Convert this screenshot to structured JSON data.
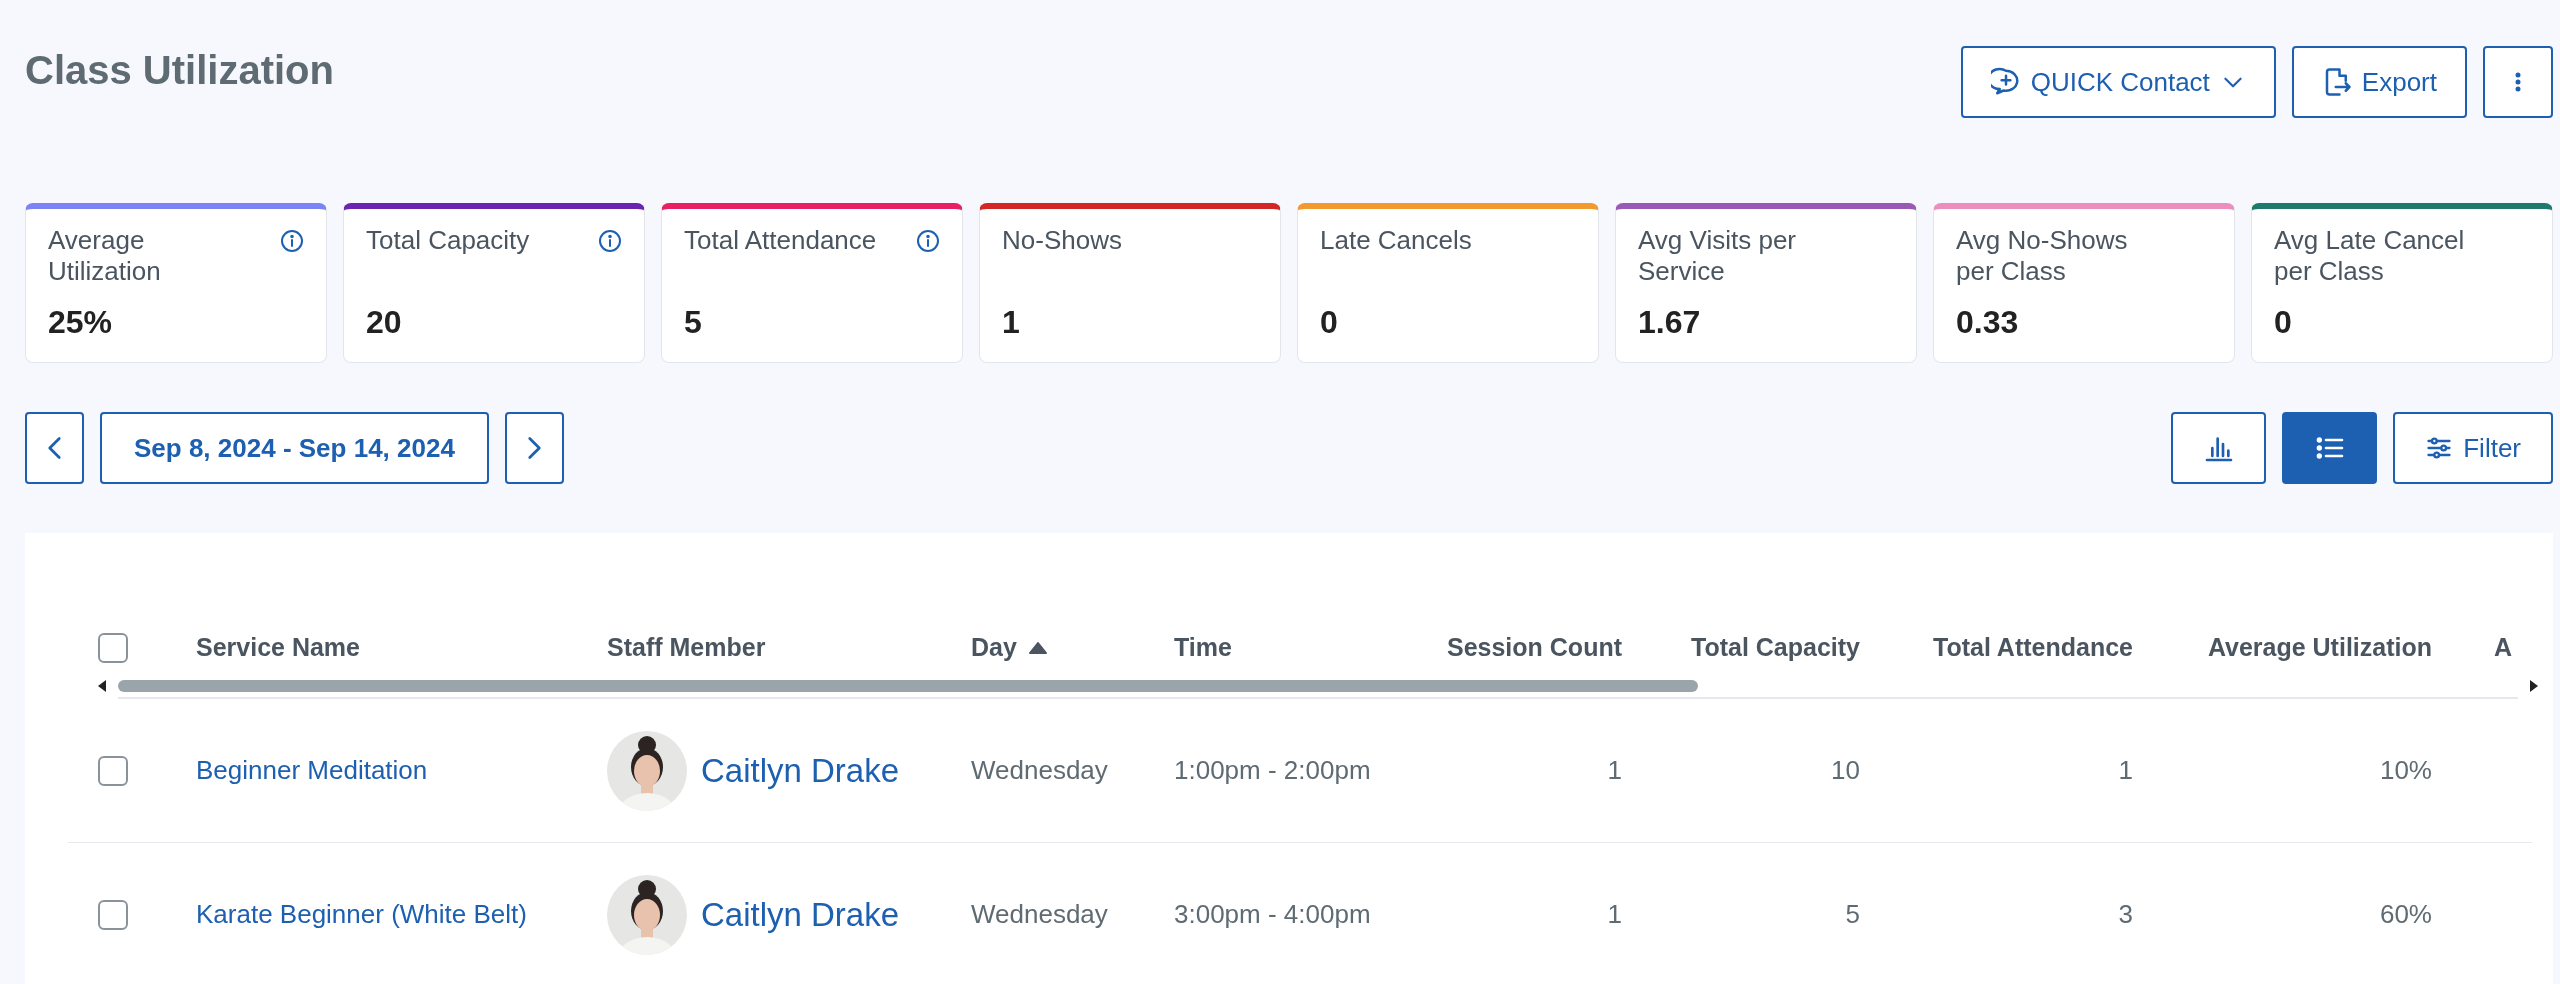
{
  "page": {
    "title": "Class Utilization"
  },
  "header_buttons": [
    {
      "kind": "contact",
      "label": "QUICK Contact"
    },
    {
      "kind": "export",
      "label": "Export"
    },
    {
      "kind": "more"
    }
  ],
  "stats": [
    {
      "label": "Average Utilization",
      "value": "25%",
      "info": true,
      "color": "#7b83f5"
    },
    {
      "label": "Total Capacity",
      "value": "20",
      "info": true,
      "color": "#6a24b0"
    },
    {
      "label": "Total Attendance",
      "value": "5",
      "info": true,
      "color": "#e91e63"
    },
    {
      "label": "No-Shows",
      "value": "1",
      "info": false,
      "color": "#d32626"
    },
    {
      "label": "Late Cancels",
      "value": "0",
      "info": false,
      "color": "#f39a2e"
    },
    {
      "label": "Avg Visits per Service",
      "value": "1.67",
      "info": false,
      "color": "#9b59b6"
    },
    {
      "label": "Avg No-Shows per Class",
      "value": "0.33",
      "info": false,
      "color": "#ec8fbf"
    },
    {
      "label": "Avg Late Cancel per Class",
      "value": "0",
      "info": false,
      "color": "#1f7a6e"
    }
  ],
  "date_range": {
    "label": "Sep 8, 2024 - Sep 14, 2024"
  },
  "view_toggle": [
    {
      "kind": "chart",
      "selected": false
    },
    {
      "kind": "list",
      "selected": true
    }
  ],
  "filter_button": {
    "label": "Filter"
  },
  "table": {
    "select_all": {
      "checked": false
    },
    "columns": [
      {
        "label": "Service Name",
        "kind": "text",
        "sorted": false
      },
      {
        "label": "Staff Member",
        "kind": "text",
        "sorted": false
      },
      {
        "label": "Day",
        "kind": "text",
        "sorted": true
      },
      {
        "label": "Time",
        "kind": "text",
        "sorted": false
      },
      {
        "label": "Session Count",
        "kind": "number",
        "sorted": false
      },
      {
        "label": "Total Capacity",
        "kind": "number",
        "sorted": false
      },
      {
        "label": "Total Attendance",
        "kind": "number",
        "sorted": false
      },
      {
        "label": "Average Utilization",
        "kind": "number",
        "sorted": false
      },
      {
        "label": "A",
        "kind": "text",
        "sorted": false
      }
    ],
    "rows": [
      {
        "checked": false,
        "cells": [
          "Beginner Meditation",
          "Caitlyn Drake",
          "Wednesday",
          "1:00pm - 2:00pm",
          "1",
          "10",
          "1",
          "10%"
        ]
      },
      {
        "checked": false,
        "cells": [
          "Karate Beginner (White Belt)",
          "Caitlyn Drake",
          "Wednesday",
          "3:00pm - 4:00pm",
          "1",
          "5",
          "3",
          "60%"
        ]
      }
    ]
  }
}
